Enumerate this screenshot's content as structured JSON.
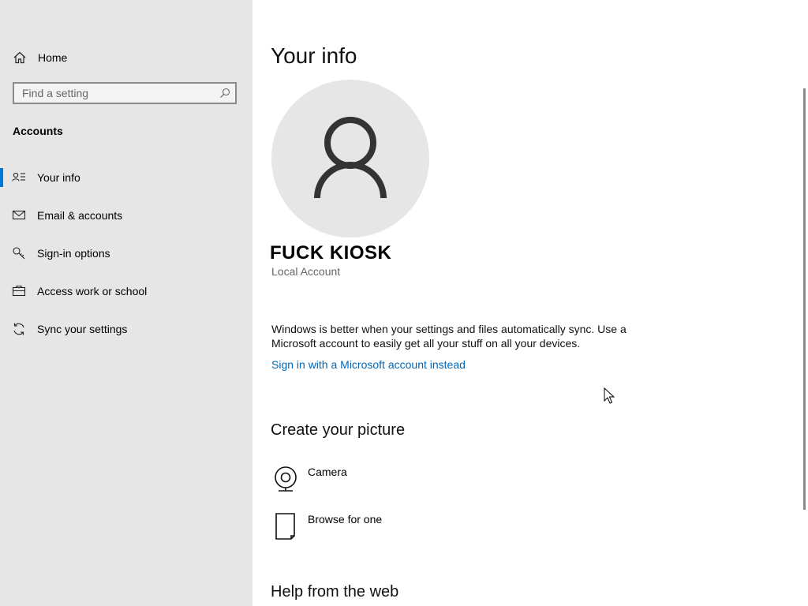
{
  "sidebar": {
    "home_label": "Home",
    "search_placeholder": "Find a setting",
    "section_title": "Accounts",
    "items": [
      {
        "label": "Your info",
        "icon": "person-list-icon",
        "selected": true
      },
      {
        "label": "Email & accounts",
        "icon": "mail-icon",
        "selected": false
      },
      {
        "label": "Sign-in options",
        "icon": "key-icon",
        "selected": false
      },
      {
        "label": "Access work or school",
        "icon": "briefcase-icon",
        "selected": false
      },
      {
        "label": "Sync your settings",
        "icon": "sync-icon",
        "selected": false
      }
    ]
  },
  "main": {
    "title": "Your info",
    "user_name": "FUCK KIOSK",
    "account_type": "Local Account",
    "sync_message": "Windows is better when your settings and files automatically sync. Use a Microsoft account to easily get all your stuff on all your devices.",
    "ms_link": "Sign in with a Microsoft account instead",
    "create_picture_heading": "Create your picture",
    "picture_options": [
      {
        "label": "Camera",
        "icon": "camera-icon"
      },
      {
        "label": "Browse for one",
        "icon": "document-icon"
      }
    ],
    "help_heading": "Help from the web"
  },
  "colors": {
    "sidebar_bg": "#e6e6e6",
    "accent": "#0078d7",
    "link": "#0067b8"
  }
}
